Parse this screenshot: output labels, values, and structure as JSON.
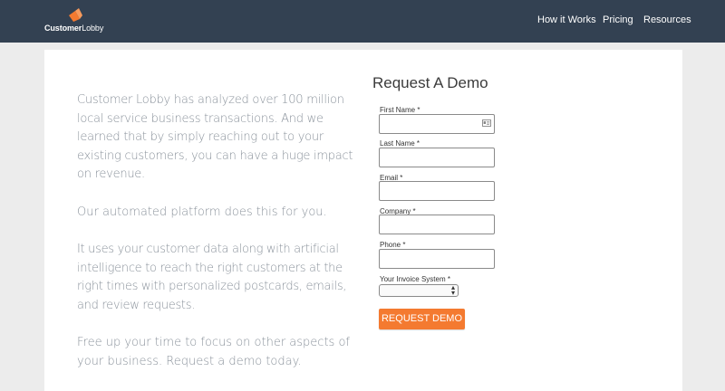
{
  "header": {
    "logo": {
      "brand_bold": "Customer",
      "brand_regular": "Lobby"
    },
    "nav": [
      "How it Works",
      "Pricing",
      "Resources"
    ]
  },
  "intro": {
    "paragraphs": [
      "Customer Lobby has analyzed over 100 million local service business transactions. And we learned that by simply reaching out to your existing customers, you can have a huge impact on revenue.",
      "Our automated platform does this for you.",
      "It uses your customer data along with artificial intelligence to reach the right customers at the right times with personalized postcards, emails, and review requests.",
      "Free up your time to focus on other aspects of your business. Request a demo today."
    ]
  },
  "form": {
    "title": "Request A Demo",
    "fields": {
      "first_name": {
        "label": "First Name *",
        "value": ""
      },
      "last_name": {
        "label": "Last Name *",
        "value": ""
      },
      "email": {
        "label": "Email *",
        "value": ""
      },
      "company": {
        "label": "Company *",
        "value": ""
      },
      "phone": {
        "label": "Phone *",
        "value": ""
      },
      "invoice_system": {
        "label": "Your Invoice System *",
        "selected": ""
      }
    },
    "submit_label": "REQUEST DEMO"
  },
  "colors": {
    "header_bg": "#334152",
    "accent_orange": "#f47a30",
    "body_text": "#8a929b"
  },
  "icons": [
    "logo-mark-icon",
    "contact-card-icon",
    "select-arrows-icon"
  ]
}
